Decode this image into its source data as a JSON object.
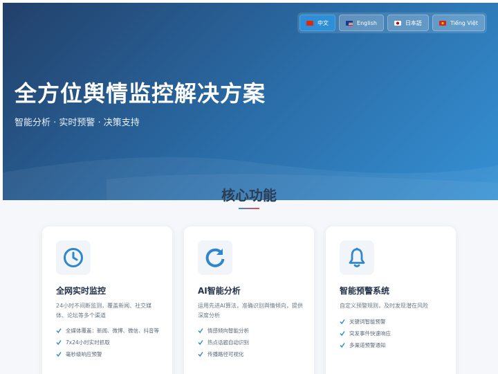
{
  "languages": [
    {
      "label": "中文",
      "flag": "cn-flag",
      "active": true
    },
    {
      "label": "English",
      "flag": "us-flag",
      "active": false
    },
    {
      "label": "日本語",
      "flag": "jp-flag",
      "active": false
    },
    {
      "label": "Tiếng Việt",
      "flag": "vn-flag",
      "active": false
    }
  ],
  "hero": {
    "title": "全方位舆情监控解决方案",
    "subtitle": "智能分析 · 实时预警 · 决策支持"
  },
  "features": {
    "title": "核心功能",
    "cards": [
      {
        "icon": "clock-icon",
        "title": "全网实时监控",
        "desc": "24小时不间断监测，覆盖新闻、社交媒体、论坛等多个渠道",
        "items": [
          "全媒体覆盖：新闻、微博、微信、抖音等",
          "7x24小时实时抓取",
          "毫秒级响应预警"
        ]
      },
      {
        "icon": "refresh-icon",
        "title": "AI智能分析",
        "desc": "运用先进AI算法，准确识别舆情倾向，提供深度分析",
        "items": [
          "情感倾向智能分析",
          "热点话题自动识别",
          "传播路径可视化"
        ]
      },
      {
        "icon": "bell-icon",
        "title": "智能预警系统",
        "desc": "自定义预警规则，及时发现潜在风险",
        "items": [
          "关键词智能预警",
          "突发事件快速响应",
          "多渠道预警通知"
        ]
      }
    ]
  },
  "colors": {
    "accent": "#3591d4",
    "hero_dark": "#22406a",
    "heading": "#2b3d55"
  }
}
